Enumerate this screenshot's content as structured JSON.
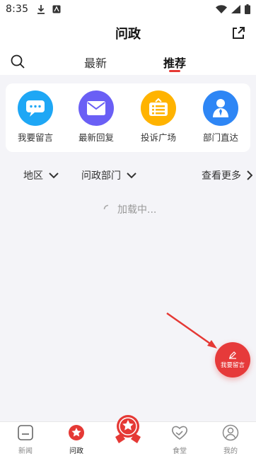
{
  "status_bar": {
    "time": "8:35"
  },
  "header": {
    "title": "问政"
  },
  "tabs": [
    {
      "label": "最新",
      "active": false
    },
    {
      "label": "推荐",
      "active": true
    }
  ],
  "quick_actions": [
    {
      "label": "我要留言",
      "icon": "chat-bubble-icon",
      "color": "#1ea7f5"
    },
    {
      "label": "最新回复",
      "icon": "mail-icon",
      "color": "#6a5ff5"
    },
    {
      "label": "投诉广场",
      "icon": "bulletin-board-icon",
      "color": "#ffb300"
    },
    {
      "label": "部门直达",
      "icon": "person-icon",
      "color": "#2e86f5"
    }
  ],
  "filters": {
    "region": "地区",
    "department": "问政部门",
    "more": "查看更多"
  },
  "loading_text": "加载中...",
  "fab": {
    "label": "我要留言"
  },
  "bottom_nav": [
    {
      "label": "新闻",
      "active": false
    },
    {
      "label": "问政",
      "active": true
    },
    {
      "label": "",
      "active": false
    },
    {
      "label": "食堂",
      "active": false
    },
    {
      "label": "我的",
      "active": false
    }
  ],
  "colors": {
    "accent": "#e53935",
    "background": "#f4f4f8"
  }
}
